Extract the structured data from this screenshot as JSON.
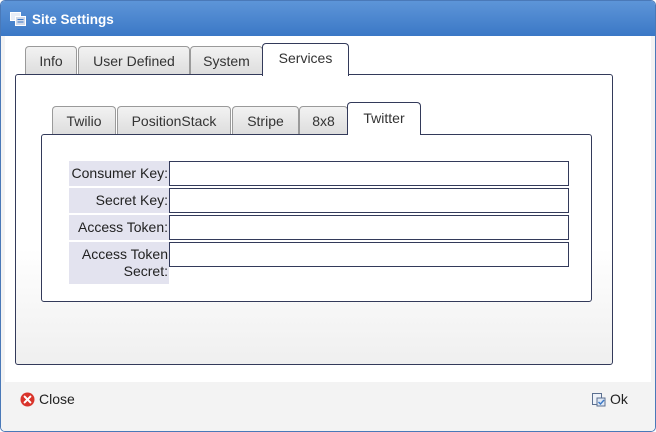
{
  "window": {
    "title": "Site Settings",
    "icon": "settings-window-icon",
    "title_bar_color": "#4a86d1"
  },
  "main_tabs": [
    {
      "label": "Info",
      "active": false
    },
    {
      "label": "User Defined",
      "active": false
    },
    {
      "label": "System",
      "active": false
    },
    {
      "label": "Services",
      "active": true
    }
  ],
  "service_tabs": [
    {
      "label": "Twilio",
      "active": false
    },
    {
      "label": "PositionStack",
      "active": false
    },
    {
      "label": "Stripe",
      "active": false
    },
    {
      "label": "8x8",
      "active": false
    },
    {
      "label": "Twitter",
      "active": true
    }
  ],
  "twitter_form": {
    "consumer_key": {
      "label": "Consumer Key:",
      "value": ""
    },
    "secret_key": {
      "label": "Secret Key:",
      "value": ""
    },
    "access_token": {
      "label": "Access Token:",
      "value": ""
    },
    "access_token_secret": {
      "label": "Access Token Secret:",
      "value": ""
    }
  },
  "footer": {
    "close_label": "Close",
    "close_icon": "close-icon",
    "ok_label": "Ok",
    "ok_icon": "ok-icon"
  },
  "colors": {
    "panel_border": "#333a5a",
    "label_background": "#e3e3ef",
    "close_icon": "#d9342b"
  }
}
